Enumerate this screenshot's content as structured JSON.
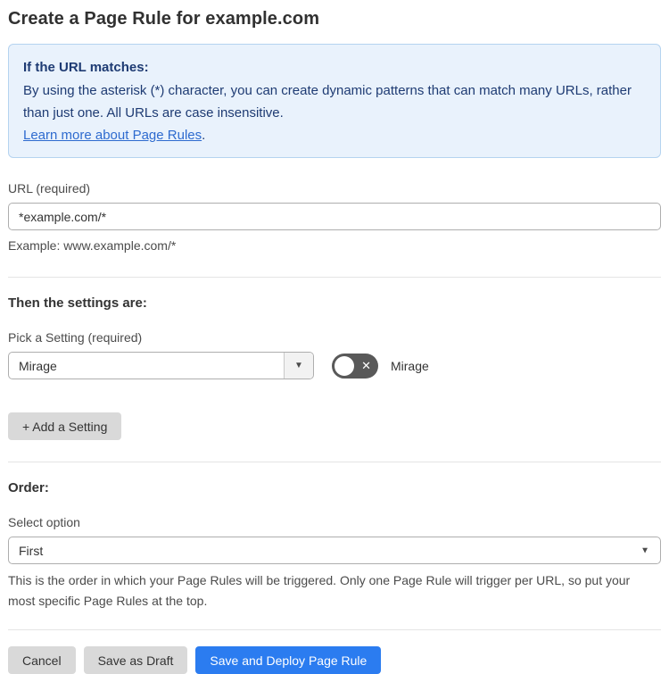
{
  "page": {
    "title": "Create a Page Rule for example.com"
  },
  "info_box": {
    "heading": "If the URL matches:",
    "body": "By using the asterisk (*) character, you can create dynamic patterns that can match many URLs, rather than just one. All URLs are case insensitive.",
    "link": "Learn more about Page Rules",
    "link_suffix": "."
  },
  "url_field": {
    "label": "URL (required)",
    "value": "*example.com/*",
    "helper": "Example: www.example.com/*"
  },
  "settings_section": {
    "heading": "Then the settings are:",
    "picker_label": "Pick a Setting (required)",
    "picker_value": "Mirage",
    "picker_arrow_icon": "▼",
    "toggle_state": "off",
    "toggle_icon": "✕",
    "toggle_label": "Mirage",
    "add_button": "+ Add a Setting"
  },
  "order_section": {
    "heading": "Order:",
    "select_label": "Select option",
    "select_value": "First",
    "select_arrow_icon": "▼",
    "helper": "This is the order in which your Page Rules will be triggered. Only one Page Rule will trigger per URL, so put your most specific Page Rules at the top."
  },
  "footer": {
    "cancel": "Cancel",
    "save_draft": "Save as Draft",
    "save_deploy": "Save and Deploy Page Rule"
  },
  "colors": {
    "accent_blue": "#2b7cf0",
    "info_box_bg": "#e9f2fc",
    "info_box_border": "#b5d3f0",
    "info_text": "#1e3b73",
    "link_blue": "#2e6bcf",
    "toggle_off_bg": "#595959",
    "gray_button_bg": "#d9d9d9"
  }
}
